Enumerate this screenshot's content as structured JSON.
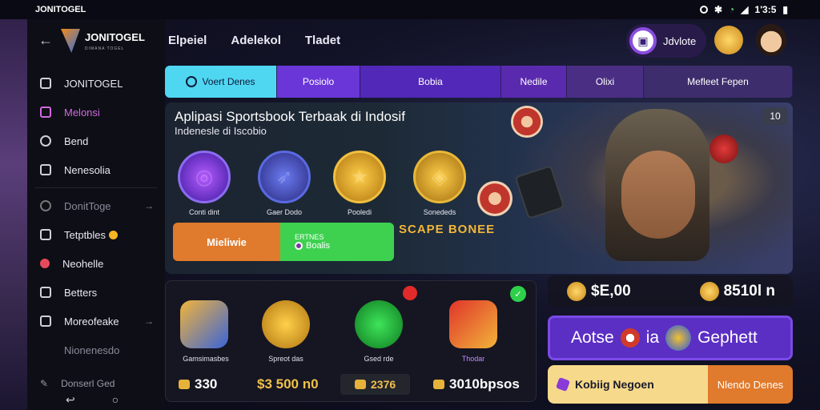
{
  "status": {
    "app_name": "JONITOGEL",
    "time": "1'3:5"
  },
  "sidebar": {
    "logo_text": "JONITOGEL",
    "logo_sub": "DIMANA TOGEL",
    "items": [
      {
        "label": "JONITOGEL"
      },
      {
        "label": "Melonsi"
      },
      {
        "label": "Bend"
      },
      {
        "label": "Nenesolia"
      },
      {
        "label": "DonitToge"
      },
      {
        "label": "Tetptbles"
      },
      {
        "label": "Neohelle"
      },
      {
        "label": "Betters"
      },
      {
        "label": "Moreofeake"
      },
      {
        "label": "Nionenesdo"
      }
    ],
    "footer": "Donserl Ged"
  },
  "header": {
    "nav": [
      "Elpeiel",
      "Adelekol",
      "Tladet"
    ],
    "user_name": "Jdvlote"
  },
  "tabs": [
    "Voert Denes",
    "Posiolo",
    "Bobia",
    "Nedile",
    "Olixi",
    "Mefleet Fepen"
  ],
  "hero": {
    "title": "Aplipasi Sportsbook Terbaak di Indosif",
    "subtitle": "Indenesle di Iscobio",
    "badge": "10",
    "games": [
      {
        "label": "Conti dint"
      },
      {
        "label": "Gaer Dodo"
      },
      {
        "label": "Pooledi"
      },
      {
        "label": "Sonededs"
      }
    ],
    "cta_left": "Mieliwie",
    "cta_right_top": "ERTNES",
    "cta_right_bottom": "Boalis",
    "promo": "SCAPE BONEE"
  },
  "bottom": {
    "items": [
      {
        "label": "Gamsimasbes",
        "value": "330"
      },
      {
        "label": "Spreot das",
        "value": "$3 500 n0"
      },
      {
        "label": "Gsed rde",
        "value": "2376"
      },
      {
        "label": "Thodar",
        "value": "3010bpsos"
      }
    ]
  },
  "balance": {
    "left": "$E,00",
    "right": "8510l n"
  },
  "purple_card": {
    "pre": "Aotse",
    "mid": "ia",
    "post": "Gephett"
  },
  "yellow_card": {
    "left": "Kobiig Negoen",
    "right": "Nlendo Denes"
  }
}
